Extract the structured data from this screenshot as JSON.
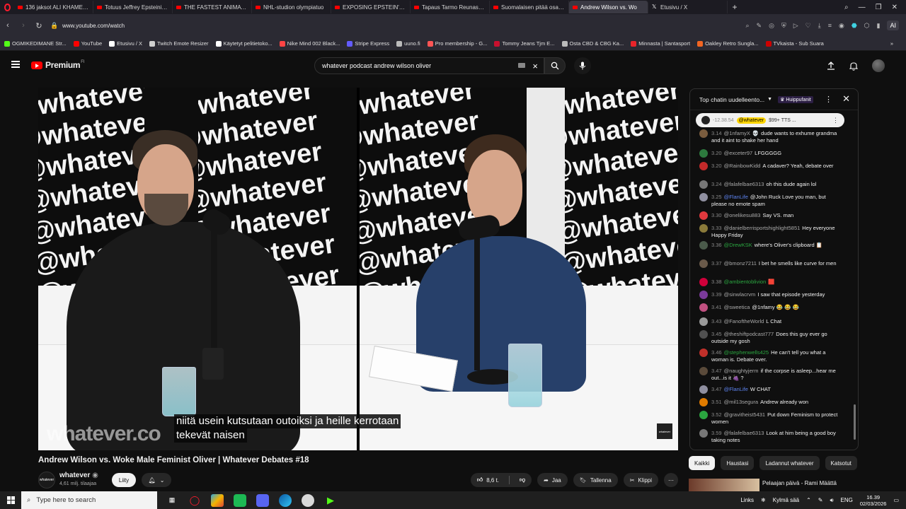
{
  "browser": {
    "tabs": [
      {
        "title": "136 jaksot ALI KHAMENEI",
        "icon": "youtube-icon",
        "active": false
      },
      {
        "title": "Totuus Jeffrey Epsteinin K",
        "icon": "youtube-icon",
        "active": false
      },
      {
        "title": "THE FASTEST ANIMATRONI",
        "icon": "youtube-icon",
        "active": false
      },
      {
        "title": "NHL-studion olympiatuo",
        "icon": "youtube-icon",
        "active": false
      },
      {
        "title": "EXPOSING EPSTEIN'S ZOR",
        "icon": "youtube-icon",
        "active": false
      },
      {
        "title": "Tapaus Tarmo Reunasen ja",
        "icon": "youtube-icon",
        "active": false
      },
      {
        "title": "Suomalaisen pitää osata p",
        "icon": "youtube-icon",
        "active": false
      },
      {
        "title": "Andrew Wilson vs. Wo",
        "icon": "youtube-icon",
        "active": true
      },
      {
        "title": "Etusivu / X",
        "icon": "x-icon",
        "active": false
      }
    ],
    "url": "www.youtube.com/watch",
    "ai_label": "AI",
    "bookmarks": [
      {
        "label": "OGMIKEDIMANE Str...",
        "color": "#53fc18"
      },
      {
        "label": "YouTube",
        "color": "#ff0000"
      },
      {
        "label": "Etusivu / X",
        "color": "#ffffff"
      },
      {
        "label": "Twitch Emote Resizer",
        "color": "#cfcfcf"
      },
      {
        "label": "Käytetyt pelitietoko...",
        "color": "#ffffff"
      },
      {
        "label": "Nike Mind 002 Black...",
        "color": "#ff4444"
      },
      {
        "label": "Stripe Express",
        "color": "#635bff"
      },
      {
        "label": "uuno.fi",
        "color": "#bbbbbb"
      },
      {
        "label": "Pro membership - G...",
        "color": "#ff5555"
      },
      {
        "label": "Tommy Jeans Tjm E...",
        "color": "#c8102e"
      },
      {
        "label": "Osta CBD & CBG Ka...",
        "color": "#bbbbbb"
      },
      {
        "label": "Minnasta | Santasport",
        "color": "#e8242a"
      },
      {
        "label": "Oakley Retro Sungla...",
        "color": "#f26522"
      },
      {
        "label": "TVkaista - Sub Suara",
        "color": "#cc0000"
      }
    ]
  },
  "yt": {
    "brand": "Premium",
    "country": "FI",
    "search_query": "whatever podcast andrew wilson oliver"
  },
  "video": {
    "banner_text": "@whatever",
    "watermark": "whatever.co",
    "badge": "whatever",
    "subtitle_line1": "niitä usein kutsutaan outoiksi ja heille kerrotaan",
    "subtitle_line2": "tekevät naisen",
    "title": "Andrew Wilson vs. Woke Male Feminist Oliver | Whatever Debates #18",
    "channel_name": "whatever",
    "subscribers": "4,61 milj. tilaajaa",
    "join_label": "Liity",
    "likes": "8,6 t.",
    "share_label": "Jaa",
    "save_label": "Tallenna",
    "clip_label": "Klippi"
  },
  "chat": {
    "header": "Top chatin uudelleento...",
    "badge": "Huippufanit",
    "pinned": {
      "time": "-12.38.54",
      "author": "@whatever",
      "text": "$99+ TTS ..."
    },
    "messages": [
      {
        "time": "3.14",
        "author": "@1nfamyX",
        "emoji": "💀",
        "text": "dude wants to exhume grandma and it aint to shake her hand",
        "color": "#7a5c3e",
        "style": ""
      },
      {
        "time": "3.20",
        "author": "@exceter97",
        "text": "LFGGGGG",
        "color": "#2d7a3e",
        "style": ""
      },
      {
        "time": "3.20",
        "author": "@RainbowKidd",
        "text": "A cadaver? Yeah, debate over",
        "color": "#c32a2a",
        "style": ""
      },
      {
        "time": "3.24",
        "author": "@falafelbae6313",
        "text": "oh this dude again lol",
        "color": "#777777",
        "style": ""
      },
      {
        "time": "3.25",
        "author": "@FlanLife",
        "text": "@John Ruck Love you man, but please no emote spam",
        "color": "#8f8fa0",
        "style": "mod"
      },
      {
        "time": "3.30",
        "author": "@onelikesu883",
        "text": "Say VS. man",
        "color": "#e0393e",
        "style": ""
      },
      {
        "time": "3.33",
        "author": "@danielberrisportshighlight5851",
        "text": "Hey everyone Happy Friday",
        "color": "#8a7a3a",
        "style": ""
      },
      {
        "time": "3.36",
        "author": "@DrewKSK",
        "text": "where's Oliver's clipboard 📋",
        "color": "#4a5a4a",
        "style": "mem"
      },
      {
        "time": "3.37",
        "author": "@bmonz7211",
        "text": "I bet he smells like curve for men",
        "color": "#6a5a4a",
        "style": ""
      },
      {
        "time": "3.38",
        "author": "@ambientoblivion",
        "text": "🟥",
        "color": "#d0003a",
        "style": "mem"
      },
      {
        "time": "3.39",
        "author": "@sinwlacrvm",
        "text": "I saw that episode yesterday",
        "color": "#7a3a9a",
        "style": ""
      },
      {
        "time": "3.41",
        "author": "@sweetica",
        "text": "@1nfamy 😂 😂 😂",
        "color": "#c05080",
        "style": ""
      },
      {
        "time": "3.43",
        "author": "@FanoftheWorld",
        "text": "L Chat",
        "color": "#999999",
        "style": ""
      },
      {
        "time": "3.45",
        "author": "@theshiftpodcast777",
        "text": "Does this guy ever go outside my gosh",
        "color": "#505050",
        "style": ""
      },
      {
        "time": "3.46",
        "author": "@stephenwells425",
        "text": "He can't tell you what a woman is. Debate over.",
        "color": "#c0302a",
        "style": "mem"
      },
      {
        "time": "3.47",
        "author": "@naughtyjerm",
        "text": "if the corpse is asleep...hear me out...is it 🍇 ?",
        "color": "#5a4a3a",
        "style": ""
      },
      {
        "time": "3.47",
        "author": "@FlanLife",
        "text": "W CHAT",
        "color": "#8f8fa0",
        "style": "mod"
      },
      {
        "time": "3.51",
        "author": "@mil13segura",
        "text": "Andrew already won",
        "color": "#e07b00",
        "style": ""
      },
      {
        "time": "3.52",
        "author": "@gravitheist5431",
        "text": "Put down Feminism to protect women",
        "color": "#2ba640",
        "style": ""
      },
      {
        "time": "3.59",
        "author": "@falafelbae6313",
        "text": "Look at him being a good boy taking notes",
        "color": "#777777",
        "style": ""
      }
    ]
  },
  "chips": [
    "Kaikki",
    "Haustasi",
    "Ladannut whatever",
    "Katsotut"
  ],
  "recommendation": {
    "title": "Pelaajan päivä - Rami Määttä"
  },
  "taskbar": {
    "search_placeholder": "Type here to search",
    "links": "Links",
    "weather": "Kylmä sää",
    "lang": "ENG",
    "time": "16.39",
    "date": "02/03/2026"
  }
}
